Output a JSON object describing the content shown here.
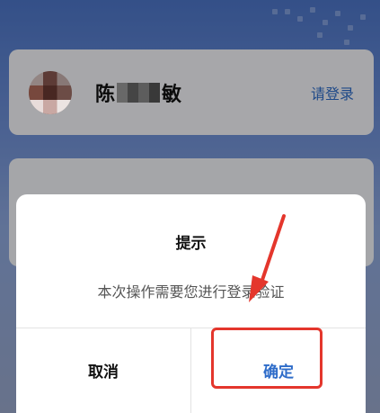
{
  "account": {
    "name_first": "陈",
    "name_last": "敏",
    "login_link": "请登录"
  },
  "dialog": {
    "title": "提示",
    "message": "本次操作需要您进行登录验证",
    "cancel_label": "取消",
    "confirm_label": "确定"
  },
  "colors": {
    "link_blue": "#2e6cc9",
    "annotation_red": "#e4362c",
    "header_blue": "#4d76c9"
  }
}
